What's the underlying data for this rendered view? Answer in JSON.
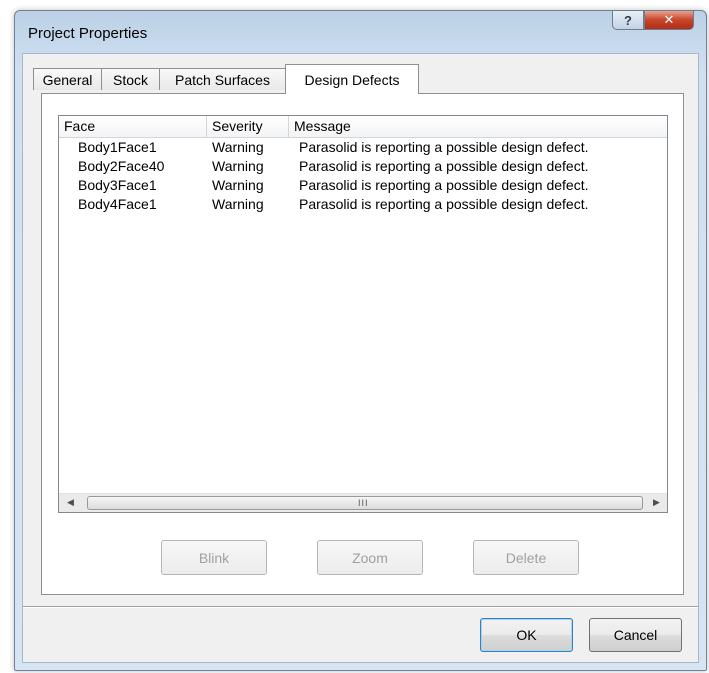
{
  "window": {
    "title": "Project Properties",
    "help_glyph": "?",
    "close_glyph": "✕"
  },
  "tabs": [
    {
      "label": "General",
      "active": false
    },
    {
      "label": "Stock",
      "active": false
    },
    {
      "label": "Patch Surfaces",
      "active": false
    },
    {
      "label": "Design Defects",
      "active": true
    }
  ],
  "list": {
    "columns": [
      "Face",
      "Severity",
      "Message"
    ],
    "rows": [
      {
        "face": "Body1Face1",
        "severity": "Warning",
        "message": "Parasolid is reporting a possible design defect."
      },
      {
        "face": "Body2Face40",
        "severity": "Warning",
        "message": "Parasolid is reporting a possible design defect."
      },
      {
        "face": "Body3Face1",
        "severity": "Warning",
        "message": "Parasolid is reporting a possible design defect."
      },
      {
        "face": "Body4Face1",
        "severity": "Warning",
        "message": "Parasolid is reporting a possible design defect."
      }
    ],
    "scrollbar": {
      "left_arrow": "◀",
      "right_arrow": "▶",
      "grip": "III"
    }
  },
  "panel_buttons": {
    "blink": "Blink",
    "zoom": "Zoom",
    "delete": "Delete"
  },
  "footer": {
    "ok": "OK",
    "cancel": "Cancel"
  }
}
